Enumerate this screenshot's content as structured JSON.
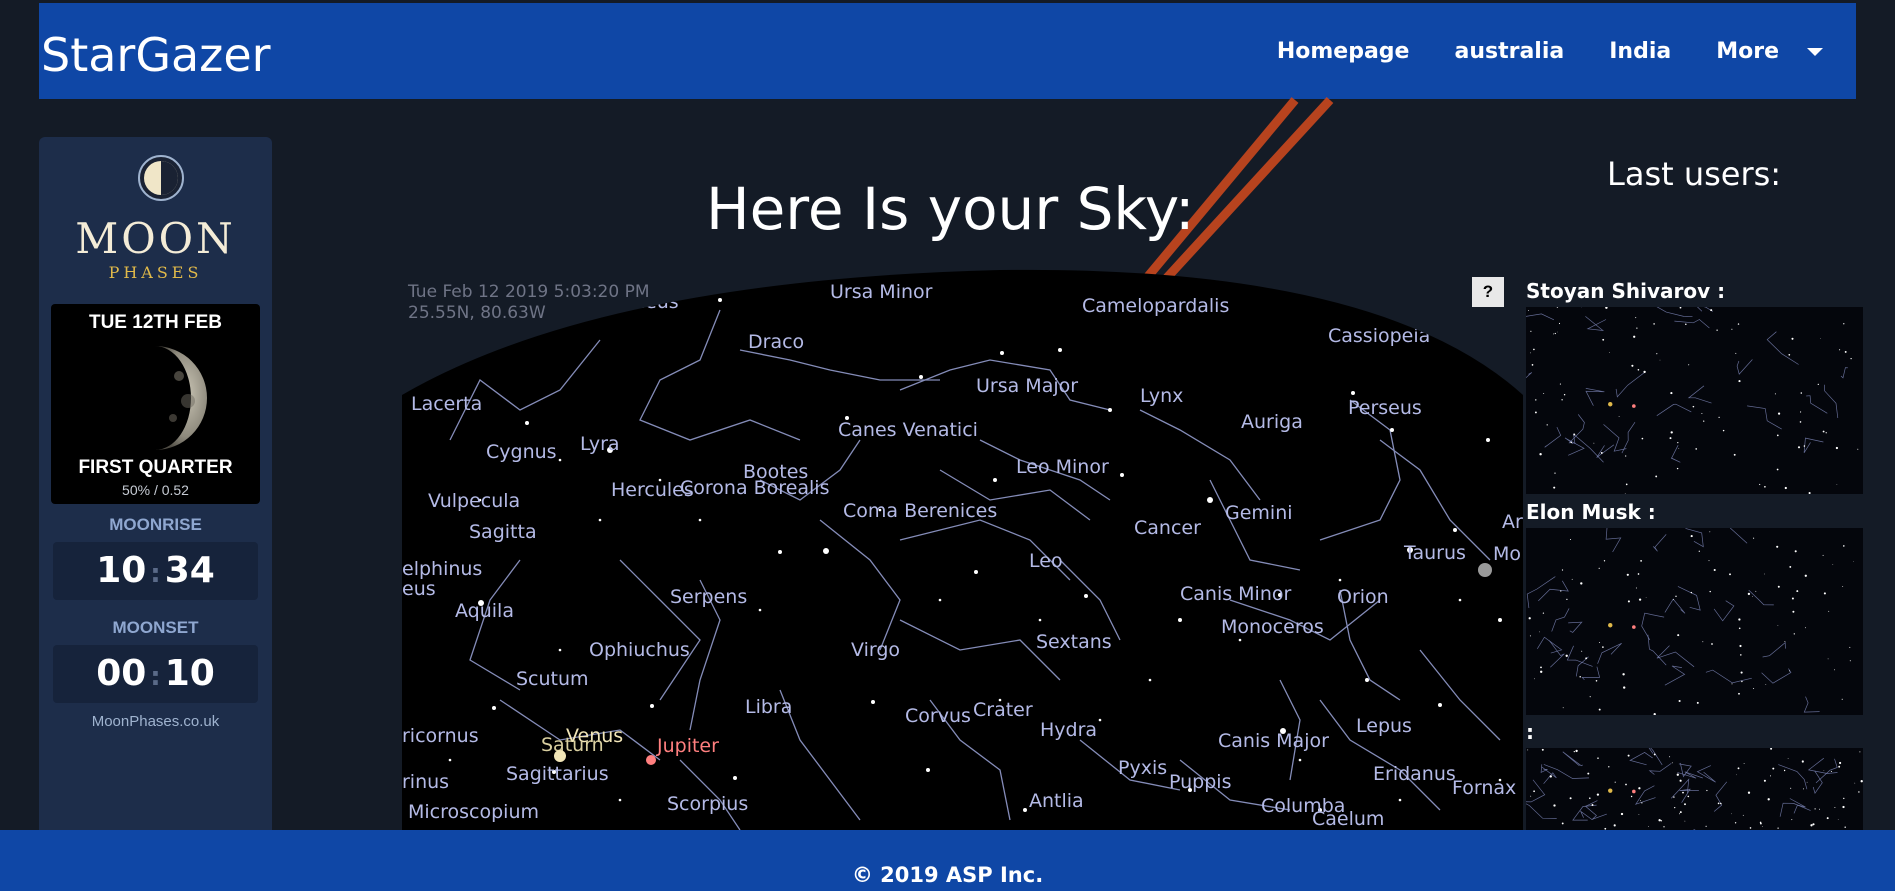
{
  "navbar": {
    "brand": "StarGazer",
    "links": [
      "Homepage",
      "australia",
      "India"
    ],
    "more_label": "More"
  },
  "moon_widget": {
    "title": "MOON",
    "subtitle": "PHASES",
    "date": "TUE 12TH FEB",
    "phase_name": "FIRST QUARTER",
    "illumination": "50% / 0.52",
    "moonrise_label": "MOONRISE",
    "moonrise_hour": "10",
    "moonrise_minute": "34",
    "moonset_label": "MOONSET",
    "moonset_hour": "00",
    "moonset_minute": "10",
    "credit": "MoonPhases.co.uk"
  },
  "sky": {
    "title": "Here Is your Sky:",
    "timestamp": "Tue Feb 12 2019 5:03:20 PM",
    "coordinates": "25.55N, 80.63W",
    "help_label": "?",
    "constellations": [
      "Ursa Minor",
      "Cepheus",
      "Camelopardalis",
      "Cassiopeia",
      "Draco",
      "Lacerta",
      "Ursa Major",
      "Lynx",
      "Perseus",
      "Auriga",
      "Canes Venatici",
      "Cygnus",
      "Lyra",
      "Bootes",
      "Leo Minor",
      "Vulpecula",
      "Hercules",
      "Corona Borealis",
      "Coma Berenices",
      "Gemini",
      "Sagitta",
      "Cancer",
      "Taurus",
      "Leo",
      "Serpens",
      "Canis Minor",
      "Orion",
      "Aquila",
      "Monoceros",
      "Ophiuchus",
      "Virgo",
      "Sextans",
      "Scutum",
      "Libra",
      "Crater",
      "Corvus",
      "Hydra",
      "Lepus",
      "Canis Major",
      "Eridanus",
      "Sagittarius",
      "Pyxis",
      "Puppis",
      "Fornax",
      "Scorpius",
      "Antlia",
      "Columba",
      "Caelum",
      "Microscopium"
    ],
    "planets": [
      "Venus",
      "Saturn",
      "Jupiter"
    ],
    "partial_labels": [
      "elphinus",
      "eus",
      "ricornus",
      "rinus",
      "Ari",
      "Mo"
    ]
  },
  "last_users": {
    "title": "Last users:",
    "users": [
      "Stoyan Shivarov :",
      "Elon Musk :",
      ":"
    ]
  },
  "footer": {
    "text": "© 2019 ASP Inc."
  },
  "colors": {
    "navbar": "#0f47a6",
    "background": "#141b26",
    "widget": "#1d2d4a",
    "constellation_label": "#b4bae6",
    "jupiter": "#ff7f7f",
    "venus": "#f2e6b8"
  },
  "icons": [
    "moon-phase-logo-icon",
    "chevron-down-icon",
    "help-icon"
  ]
}
